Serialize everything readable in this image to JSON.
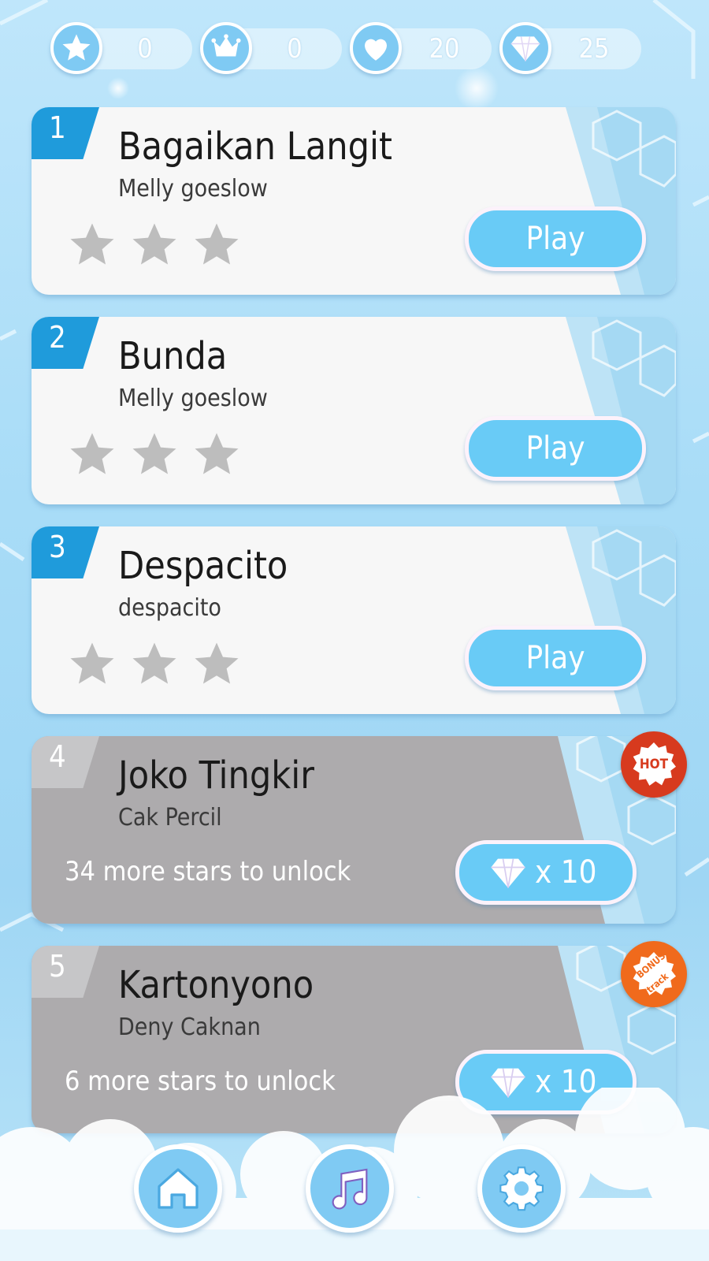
{
  "stats": {
    "stars": "0",
    "crowns": "0",
    "hearts": "20",
    "gems": "25"
  },
  "songs": [
    {
      "number": "1",
      "title": "Bagaikan Langit",
      "artist": "Melly goeslow",
      "stars_earned": 0,
      "stars_total": 3,
      "play_label": "Play",
      "locked": false
    },
    {
      "number": "2",
      "title": "Bunda",
      "artist": "Melly goeslow",
      "stars_earned": 0,
      "stars_total": 3,
      "play_label": "Play",
      "locked": false
    },
    {
      "number": "3",
      "title": "Despacito",
      "artist": "despacito",
      "stars_earned": 0,
      "stars_total": 3,
      "play_label": "Play",
      "locked": false
    },
    {
      "number": "4",
      "title": "Joko Tingkir",
      "artist": "Cak Percil",
      "locked": true,
      "unlock_text": "34 more stars to unlock",
      "unlock_cost": "x 10",
      "badge": "HOT"
    },
    {
      "number": "5",
      "title": "Kartonyono",
      "artist": "Deny Caknan",
      "locked": true,
      "unlock_text": "6 more stars to unlock",
      "unlock_cost": "x 10",
      "badge_line1": "BONUS",
      "badge_line2": "track"
    }
  ],
  "nav": {
    "items": [
      "home-icon",
      "music-note-icon",
      "gear-icon"
    ]
  },
  "colors": {
    "accent": "#1f9bdb",
    "button": "#69cbf6",
    "locked_card": "#adabad",
    "hot_badge": "#d73a1e",
    "bonus_badge": "#f06a1c"
  }
}
